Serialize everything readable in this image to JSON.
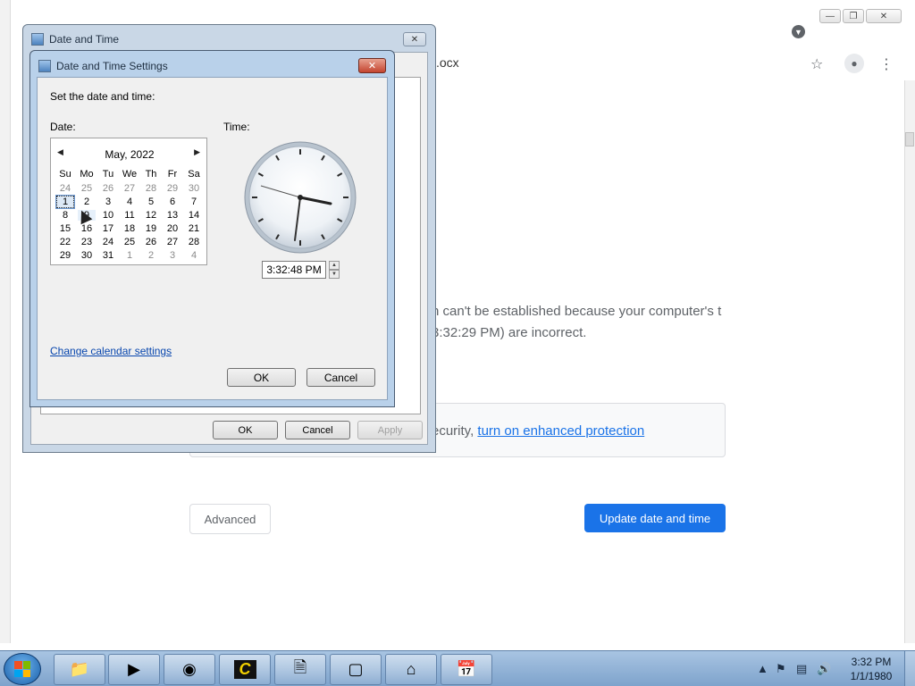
{
  "browser": {
    "omnibox_text": ".ocx",
    "error_text": "n can't be established because your computer's t 3:32:29 PM) are incorrect.",
    "help_prefix": "ecurity, ",
    "help_link": "turn on enhanced protection",
    "advanced_label": "Advanced",
    "update_label": "Update date and time",
    "accent": "#1a73e8"
  },
  "outer_window": {
    "title": "Date and Time",
    "ok_label": "OK",
    "cancel_label": "Cancel",
    "apply_label": "Apply"
  },
  "dialog": {
    "title": "Date and Time Settings",
    "instruction": "Set the date and time:",
    "date_label": "Date:",
    "time_label": "Time:",
    "calendar": {
      "month": "May, 2022",
      "weekdays": [
        "Su",
        "Mo",
        "Tu",
        "We",
        "Th",
        "Fr",
        "Sa"
      ],
      "weeks": [
        [
          "24",
          "25",
          "26",
          "27",
          "28",
          "29",
          "30"
        ],
        [
          "1",
          "2",
          "3",
          "4",
          "5",
          "6",
          "7"
        ],
        [
          "8",
          "9",
          "10",
          "11",
          "12",
          "13",
          "14"
        ],
        [
          "15",
          "16",
          "17",
          "18",
          "19",
          "20",
          "21"
        ],
        [
          "22",
          "23",
          "24",
          "25",
          "26",
          "27",
          "28"
        ],
        [
          "29",
          "30",
          "31",
          "1",
          "2",
          "3",
          "4"
        ]
      ],
      "selected": "1"
    },
    "time_value": "3:32:48 PM",
    "calendar_link": "Change calendar settings",
    "ok_label": "OK",
    "cancel_label": "Cancel"
  },
  "taskbar": {
    "apps": [
      "explorer-icon",
      "media-player-icon",
      "chrome-icon",
      "c-app-icon",
      "notepad-icon",
      "window-icon",
      "homegroup-icon",
      "date-time-icon"
    ],
    "clock_time": "3:32 PM",
    "clock_date": "1/1/1980"
  }
}
